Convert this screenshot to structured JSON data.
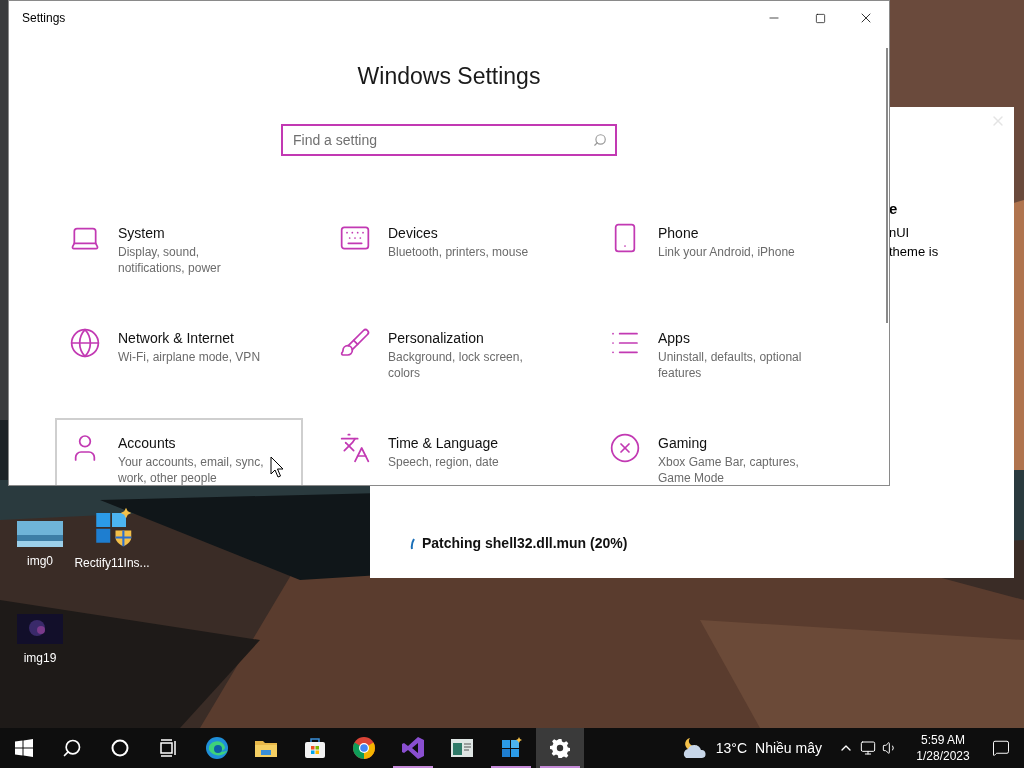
{
  "settings_window": {
    "title": "Settings",
    "heading": "Windows Settings",
    "search": {
      "placeholder": "Find a setting"
    },
    "tiles": [
      {
        "title": "System",
        "subtitle": "Display, sound, notifications, power",
        "highlighted": false
      },
      {
        "title": "Devices",
        "subtitle": "Bluetooth, printers, mouse",
        "highlighted": false
      },
      {
        "title": "Phone",
        "subtitle": "Link your Android, iPhone",
        "highlighted": false
      },
      {
        "title": "Network & Internet",
        "subtitle": "Wi-Fi, airplane mode, VPN",
        "highlighted": false
      },
      {
        "title": "Personalization",
        "subtitle": "Background, lock screen, colors",
        "highlighted": false
      },
      {
        "title": "Apps",
        "subtitle": "Uninstall, defaults, optional features",
        "highlighted": false
      },
      {
        "title": "Accounts",
        "subtitle": "Your accounts, email, sync, work, other people",
        "highlighted": true
      },
      {
        "title": "Time & Language",
        "subtitle": "Speech, region, date",
        "highlighted": false
      },
      {
        "title": "Gaming",
        "subtitle": "Xbox Game Bar, captures, Game Mode",
        "highlighted": false
      }
    ]
  },
  "installer_window": {
    "title_fragment": "e",
    "text_lines": [
      "nUI",
      "theme is"
    ],
    "status": "Patching shell32.dll.mun (20%)"
  },
  "desktop_icons": [
    {
      "label": "img0"
    },
    {
      "label": "Rectify11Ins..."
    },
    {
      "label": "img19"
    }
  ],
  "taskbar": {
    "buttons": [
      {
        "running": false,
        "selected": false
      },
      {
        "running": false,
        "selected": false
      },
      {
        "running": false,
        "selected": false
      },
      {
        "running": false,
        "selected": false
      },
      {
        "running": false,
        "selected": false
      },
      {
        "running": false,
        "selected": false
      },
      {
        "running": false,
        "selected": false
      },
      {
        "running": false,
        "selected": false
      },
      {
        "running": true,
        "selected": false
      },
      {
        "running": false,
        "selected": false
      },
      {
        "running": true,
        "selected": false
      },
      {
        "running": true,
        "selected": true
      }
    ],
    "weather": {
      "temperature": "13°C",
      "condition": "Nhiều mây"
    },
    "time": "5:59 AM",
    "date": "1/28/2023"
  }
}
